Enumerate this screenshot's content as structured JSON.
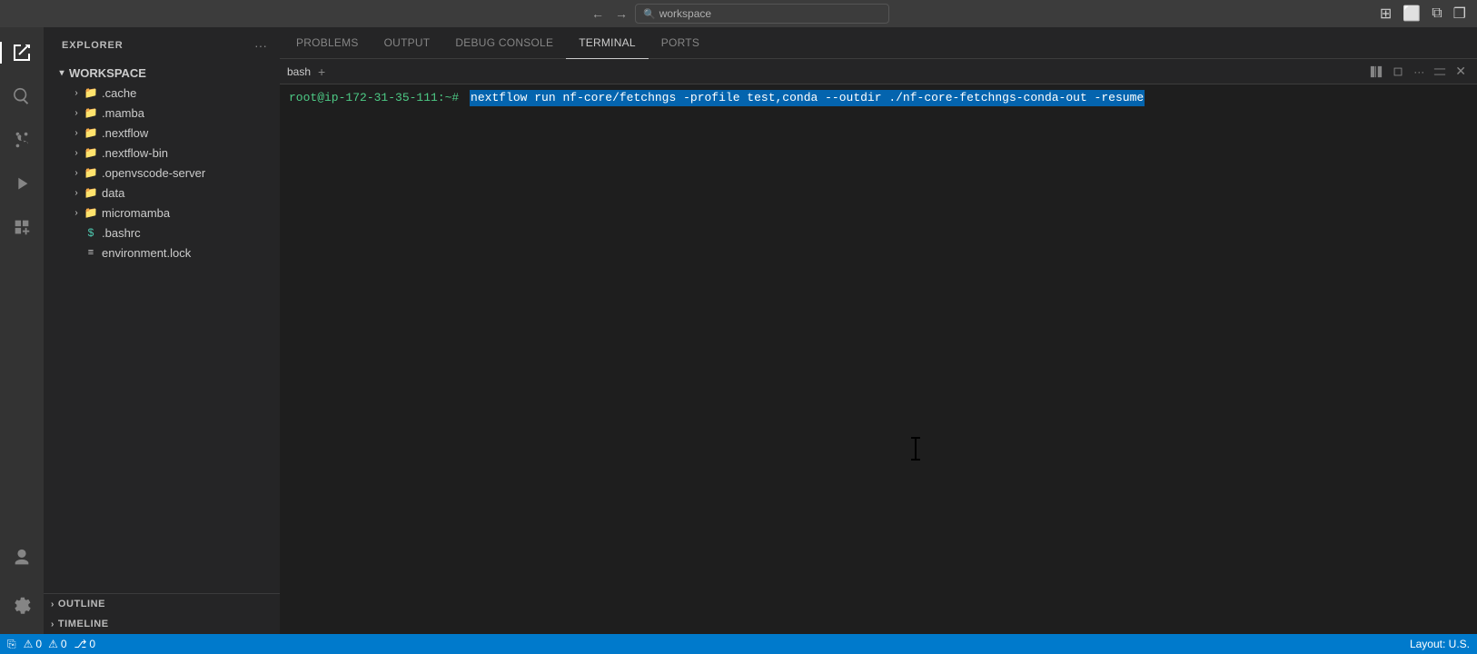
{
  "titleBar": {
    "backLabel": "←",
    "forwardLabel": "→",
    "searchPlaceholder": "workspace",
    "searchIcon": "🔍",
    "rightIcons": [
      "⊞",
      "⬜",
      "⧉",
      "❐"
    ]
  },
  "activityBar": {
    "icons": [
      {
        "name": "explorer-icon",
        "symbol": "⎘",
        "active": true
      },
      {
        "name": "search-icon",
        "symbol": "🔍",
        "active": false
      },
      {
        "name": "source-control-icon",
        "symbol": "⎇",
        "active": false
      },
      {
        "name": "debug-icon",
        "symbol": "▷",
        "active": false
      },
      {
        "name": "extensions-icon",
        "symbol": "⊞",
        "active": false
      }
    ],
    "bottomIcons": [
      {
        "name": "account-icon",
        "symbol": "👤"
      },
      {
        "name": "settings-icon",
        "symbol": "⚙"
      }
    ]
  },
  "sidebar": {
    "title": "EXPLORER",
    "moreActionsLabel": "···",
    "workspace": {
      "label": "WORKSPACE",
      "items": [
        {
          "label": ".cache",
          "type": "folder",
          "indent": 1
        },
        {
          "label": ".mamba",
          "type": "folder",
          "indent": 1
        },
        {
          "label": ".nextflow",
          "type": "folder",
          "indent": 1
        },
        {
          "label": ".nextflow-bin",
          "type": "folder",
          "indent": 1
        },
        {
          "label": ".openvscode-server",
          "type": "folder",
          "indent": 1
        },
        {
          "label": "data",
          "type": "folder",
          "indent": 1
        },
        {
          "label": "micromamba",
          "type": "folder",
          "indent": 1
        },
        {
          "label": ".bashrc",
          "type": "file-dollar",
          "indent": 1
        },
        {
          "label": "environment.lock",
          "type": "file-lock",
          "indent": 1
        }
      ]
    },
    "outline": {
      "label": "OUTLINE"
    },
    "timeline": {
      "label": "TIMELINE"
    }
  },
  "panelTabs": [
    {
      "label": "PROBLEMS",
      "active": false
    },
    {
      "label": "OUTPUT",
      "active": false
    },
    {
      "label": "DEBUG CONSOLE",
      "active": false
    },
    {
      "label": "TERMINAL",
      "active": true
    },
    {
      "label": "PORTS",
      "active": false
    }
  ],
  "terminal": {
    "prompt": "root@ip-172-31-35-111:~#",
    "commandHighlight": "nextflow run nf-core/fetchngs -profile test,conda --outdir ./nf-core-fetchngs-conda-out -resume",
    "commandSuffix": "",
    "bashLabel": "bash",
    "addIcon": "+",
    "toolbarIcons": [
      "⊞",
      "⧉",
      "✕"
    ]
  },
  "statusBar": {
    "leftItems": [
      {
        "label": "⎇",
        "name": "branch-icon"
      },
      {
        "label": "⚠ 0",
        "name": "errors"
      },
      {
        "label": "⚠ 0",
        "name": "warnings"
      },
      {
        "label": "⎇ 0",
        "name": "git-changes"
      }
    ],
    "rightItems": [
      {
        "label": "Layout: U.S.",
        "name": "layout"
      }
    ]
  }
}
